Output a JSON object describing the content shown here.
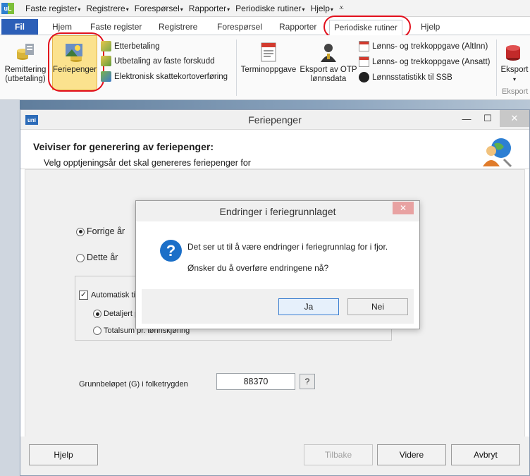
{
  "menubar": {
    "logo": "uL",
    "items": [
      {
        "label": "Faste register",
        "caret": "▾"
      },
      {
        "label": "Registrere",
        "caret": "▾"
      },
      {
        "label": "Forespørsel",
        "caret": "▾"
      },
      {
        "label": "Rapporter",
        "caret": "▾"
      },
      {
        "label": "Periodiske rutiner",
        "caret": "▾"
      },
      {
        "label": "Hjelp",
        "caret": "▾"
      }
    ],
    "overflow": "⩡"
  },
  "ribbon_tabs": {
    "fil": "Fil",
    "tabs": [
      "Hjem",
      "Faste register",
      "Registrere",
      "Forespørsel",
      "Rapporter"
    ],
    "active": "Periodiske rutiner",
    "hjelp": "Hjelp"
  },
  "ribbon": {
    "remittering": "Remittering (utbetaling)",
    "feriepenger": "Feriepenger",
    "etterbetaling": "Etterbetaling",
    "utbetaling_forskudd": "Utbetaling av faste forskudd",
    "skattekort": "Elektronisk skattekortoverføring",
    "terminoppgave": "Terminoppgave",
    "eksport_otp": "Eksport av OTP lønnsdata",
    "altinn": "Lønns- og trekkoppgave (AltInn)",
    "ansatt": "Lønns- og trekkoppgave (Ansatt)",
    "ssb": "Lønnsstatistikk til SSB",
    "eksport": "Eksport",
    "eksport_group": "Eksport"
  },
  "window": {
    "logo": "uni",
    "title": "Feriepenger",
    "minimize": "—",
    "maximize": "☐",
    "close": "✕"
  },
  "wizard": {
    "title": "Veiviser for generering av feriepenger:",
    "subtitle": "Velg opptjeningsår det skal genereres feriepenger for",
    "year_options": [
      "Forrige år",
      "Dette år"
    ],
    "auto_label": "Automatisk til",
    "auto_checkmark": "✓",
    "detail_option": "Detaljert p",
    "total_option": "Totalsum pr. lønnskjøring",
    "grunnbelop_label": "Grunnbeløpet (G) i folketrygden",
    "grunnbelop_value": "88370",
    "grunnbelop_help": "?"
  },
  "footer": {
    "help": "Hjelp",
    "back": "Tilbake",
    "next": "Videre",
    "cancel": "Avbryt"
  },
  "modal": {
    "title": "Endringer i feriegrunnlaget",
    "close": "✕",
    "icon": "?",
    "message1": "Det ser ut til å være endringer i feriegrunnlag for i fjor.",
    "message2": "Ønsker du å overføre endringene nå?",
    "ok": "Ja",
    "cancel": "Nei"
  },
  "colors": {
    "accent": "#2c5fb8",
    "highlight": "#e2101d",
    "selected_ribbon": "#fbe28e"
  }
}
